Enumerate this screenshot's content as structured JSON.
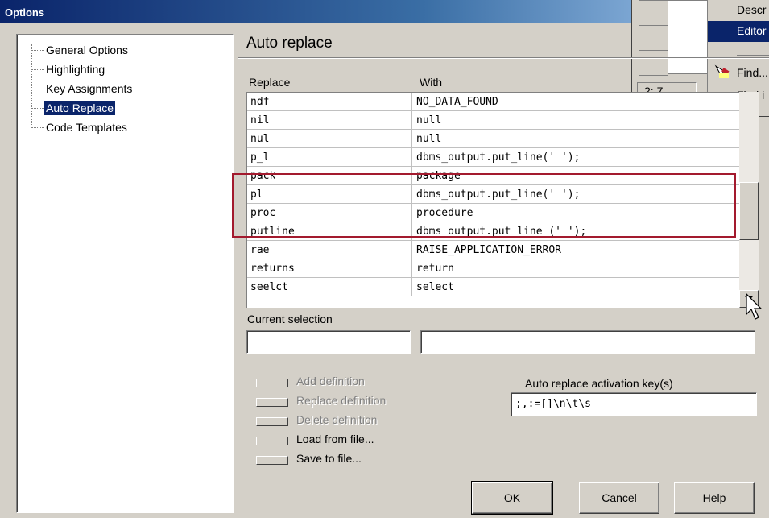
{
  "window": {
    "title": "Options"
  },
  "tree": {
    "items": [
      {
        "label": "General Options",
        "selected": false
      },
      {
        "label": "Highlighting",
        "selected": false
      },
      {
        "label": "Key Assignments",
        "selected": false
      },
      {
        "label": "Auto Replace",
        "selected": true
      },
      {
        "label": "Code Templates",
        "selected": false
      }
    ]
  },
  "panel": {
    "title": "Auto replace",
    "col_replace": "Replace",
    "col_with": "With"
  },
  "table": {
    "rows": [
      {
        "replace": "ndf",
        "with": "NO_DATA_FOUND"
      },
      {
        "replace": "nil",
        "with": "null"
      },
      {
        "replace": "nul",
        "with": "null"
      },
      {
        "replace": "p_l",
        "with": "dbms_output.put_line(' ');"
      },
      {
        "replace": "pack",
        "with": "package"
      },
      {
        "replace": "pl",
        "with": "dbms_output.put_line(' ');"
      },
      {
        "replace": "proc",
        "with": "procedure"
      },
      {
        "replace": "putline",
        "with": "dbms_output.put_line ('   ');"
      },
      {
        "replace": "rae",
        "with": "RAISE_APPLICATION_ERROR"
      },
      {
        "replace": "returns",
        "with": "return"
      },
      {
        "replace": "seelct",
        "with": "select"
      }
    ]
  },
  "current_selection": {
    "label": "Current selection",
    "replace_value": "",
    "with_value": ""
  },
  "actions": {
    "add": "Add definition",
    "replace": "Replace definition",
    "delete": "Delete definition",
    "load": "Load from file...",
    "save": "Save to file..."
  },
  "activation": {
    "label": "Auto replace activation key(s)",
    "value": ";,:=[]\\n\\t\\s"
  },
  "dialog_buttons": {
    "ok": "OK",
    "cancel": "Cancel",
    "help": "Help"
  },
  "background_editor": {
    "status": "2:  7"
  },
  "context_menu": {
    "items": [
      "Descr",
      "Editor",
      "Find...",
      "Find i"
    ],
    "selected": "Editor"
  },
  "colors": {
    "titlebar": "#0a246a",
    "selection": "#0a246a",
    "highlight_box": "#a31a2e",
    "face": "#d4d0c8"
  }
}
